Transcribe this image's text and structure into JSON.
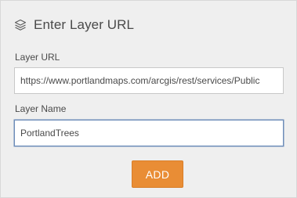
{
  "header": {
    "icon": "layers-icon",
    "title": "Enter Layer URL"
  },
  "form": {
    "url_field": {
      "label": "Layer URL",
      "value": "https://www.portlandmaps.com/arcgis/rest/services/Public"
    },
    "name_field": {
      "label": "Layer Name",
      "value": "PortlandTrees"
    },
    "submit_label": "ADD"
  },
  "colors": {
    "panel_background": "#efefef",
    "accent_button": "#e98d35",
    "focus_border": "#6e8db9",
    "text": "#4a4a4a"
  }
}
